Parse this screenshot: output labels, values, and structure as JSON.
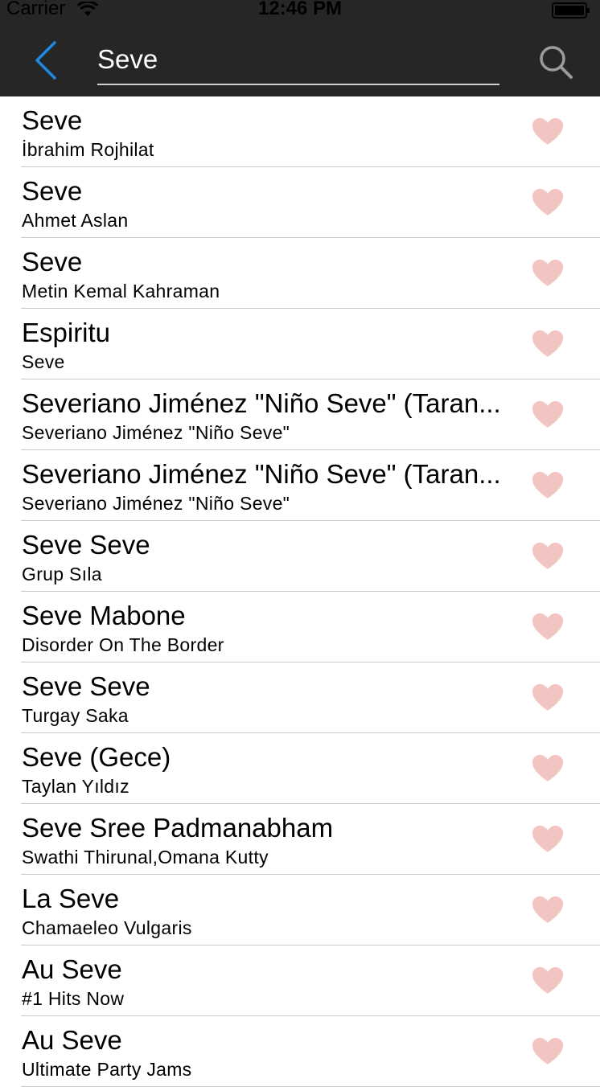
{
  "status_bar": {
    "carrier": "Carrier",
    "time": "12:46 PM"
  },
  "nav": {
    "search_value": "Seve",
    "back_icon": "chevron-left-icon",
    "search_icon": "search-icon"
  },
  "colors": {
    "bar": "#262626",
    "back_accent": "#1e88e5",
    "heart": "#f2c4c2",
    "separator": "#cbcbcb"
  },
  "results": [
    {
      "title": "Seve",
      "subtitle": "İbrahim Rojhilat"
    },
    {
      "title": "Seve",
      "subtitle": "Ahmet Aslan"
    },
    {
      "title": "Seve",
      "subtitle": "Metin Kemal Kahraman"
    },
    {
      "title": "Espiritu",
      "subtitle": "Seve"
    },
    {
      "title": "Severiano Jiménez \"Niño Seve\" (Taran...",
      "subtitle": "Severiano Jiménez \"Niño Seve\""
    },
    {
      "title": "Severiano Jiménez \"Niño Seve\" (Taran...",
      "subtitle": "Severiano Jiménez \"Niño Seve\""
    },
    {
      "title": "Seve Seve",
      "subtitle": "Grup Sıla"
    },
    {
      "title": "Seve Mabone",
      "subtitle": "Disorder On The Border"
    },
    {
      "title": "Seve Seve",
      "subtitle": "Turgay Saka"
    },
    {
      "title": "Seve (Gece)",
      "subtitle": "Taylan Yıldız"
    },
    {
      "title": "Seve Sree Padmanabham",
      "subtitle": "Swathi Thirunal,Omana Kutty"
    },
    {
      "title": "La Seve",
      "subtitle": "Chamaeleo Vulgaris"
    },
    {
      "title": "Au Seve",
      "subtitle": "#1 Hits Now"
    },
    {
      "title": "Au Seve",
      "subtitle": "Ultimate Party Jams"
    }
  ]
}
